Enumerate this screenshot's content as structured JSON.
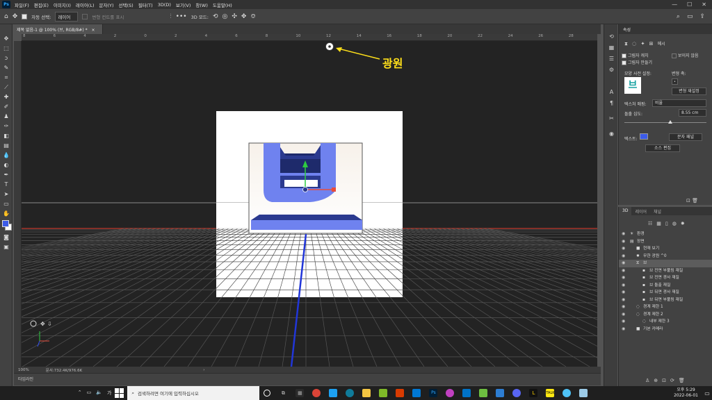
{
  "menubar": {
    "items": [
      "파일(F)",
      "편집(E)",
      "이미지(I)",
      "레이어(L)",
      "문자(Y)",
      "선택(S)",
      "필터(T)",
      "3D(D)",
      "보기(V)",
      "창(W)",
      "도움말(H)"
    ],
    "minimize": "—",
    "maximize": "☐",
    "close": "✕"
  },
  "options": {
    "auto_select_label": "자동 선택:",
    "auto_select_value": "레이어",
    "transform_controls": "변형 컨트롤 표시",
    "mode_3d": "3D 모드:"
  },
  "document": {
    "tab_title": "제목 없음-1 @ 100% (브, RGB/8#) *",
    "close_icon": "×"
  },
  "ruler": {
    "top_numbers": [
      "8",
      "6",
      "4",
      "2",
      "0",
      "2",
      "4",
      "6",
      "8",
      "10",
      "12",
      "14",
      "16",
      "18",
      "20",
      "22",
      "24",
      "26",
      "28"
    ]
  },
  "canvas": {
    "annotation_label": "광원"
  },
  "status": {
    "zoom": "100%",
    "doc_size": "문서:732.4K/976.6K",
    "arrow": "›"
  },
  "timeline": {
    "label": "타임라인"
  },
  "properties": {
    "title": "속성",
    "mesh_label": "메시",
    "catch_shadows": "그림자 캐치",
    "cast_shadows": "그림자 만들기",
    "invisible": "보이지 않음",
    "shape_preset": "모양 사전 설정:",
    "deform_axis": "변형 축:",
    "reset_deform": "변형 재설정",
    "texture_mapping_label": "텍스처 매핑:",
    "texture_mapping_value": "비율",
    "extrusion_depth_label": "돌출 심도:",
    "extrusion_depth_value": "8.55 cm",
    "text_label": "텍스트:",
    "char_panel_btn": "문자 패널",
    "edit_source_btn": "소스 편집",
    "text_color": "#3c5be8",
    "preset_glyph": "브"
  },
  "panel3d": {
    "tabs": [
      "3D",
      "레이어",
      "채널"
    ],
    "rows": [
      {
        "label": "환경",
        "indent": 0
      },
      {
        "label": "장면",
        "indent": 0
      },
      {
        "label": "현재 보기",
        "indent": 1
      },
      {
        "label": "무한 광원 ^0",
        "indent": 1
      },
      {
        "label": "브",
        "indent": 1
      },
      {
        "label": "브 전면 부풀림 재질",
        "indent": 2
      },
      {
        "label": "브 전면 경사 재질",
        "indent": 2
      },
      {
        "label": "브 돌출 재질",
        "indent": 2
      },
      {
        "label": "브 뒤면 경사 재질",
        "indent": 2
      },
      {
        "label": "브 뒤면 부풀림 재질",
        "indent": 2
      },
      {
        "label": "경계 제한 1",
        "indent": 1
      },
      {
        "label": "경계 제한 2",
        "indent": 1
      },
      {
        "label": "내부 제한 3",
        "indent": 2
      },
      {
        "label": "기본 카메라",
        "indent": 1
      }
    ]
  },
  "taskbar": {
    "search_placeholder": "검색하려면 여기에 입력하십시오",
    "time": "오후 5:29",
    "date": "2022-06-01",
    "ime": "가"
  },
  "colors": {
    "accent_blue": "#3c5be8",
    "annotation_yellow": "#ffe01a",
    "horizon_red": "#c0392b"
  }
}
